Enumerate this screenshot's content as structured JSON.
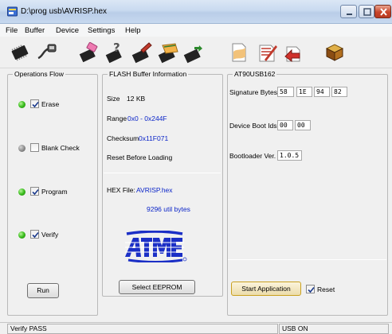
{
  "window": {
    "title": "D:\\prog usb\\AVRISP.hex"
  },
  "menu": [
    "File",
    "Buffer",
    "Device",
    "Settings",
    "Help"
  ],
  "toolbar": {
    "icons": [
      "chip-select-icon",
      "usb-connect-icon",
      "erase-chip-icon",
      "blank-check-icon",
      "program-chip-icon",
      "verify-chip-icon",
      "read-chip-icon",
      "load-hex-icon",
      "edit-buffer-icon",
      "save-buffer-icon",
      "help-book-icon"
    ]
  },
  "operations": {
    "title": "Operations Flow",
    "items": [
      {
        "label": "Erase",
        "checked": true,
        "led": "on"
      },
      {
        "label": "Blank Check",
        "checked": false,
        "led": "off"
      },
      {
        "label": "Program",
        "checked": true,
        "led": "on"
      },
      {
        "label": "Verify",
        "checked": true,
        "led": "on"
      }
    ],
    "run_label": "Run"
  },
  "flash": {
    "title": "FLASH Buffer Information",
    "size_label": "Size",
    "size_value": "12 KB",
    "range_label": "Range",
    "range_value": "0x0 - 0x244F",
    "checksum_label": "Checksum",
    "checksum_value": "0x11F071",
    "reset_text": "Reset Before Loading",
    "hex_label": "HEX File:",
    "hex_file": "AVRISP.hex",
    "util_bytes": "9296 util bytes",
    "logo_text": "AtMEL",
    "select_eeprom_label": "Select EEPROM"
  },
  "device": {
    "title": "AT90USB162",
    "signature_label": "Signature Bytes",
    "signature_bytes": [
      "58",
      "1E",
      "94",
      "82"
    ],
    "boot_ids_label": "Device Boot Ids",
    "boot_ids": [
      "00",
      "00"
    ],
    "bootloader_label": "Bootloader Ver.",
    "bootloader_version": "1.0.5",
    "start_app_label": "Start Application",
    "reset_label": "Reset",
    "reset_checked": true
  },
  "status": {
    "left": "Verify PASS",
    "right": "USB ON"
  },
  "colors": {
    "accent_blue": "#0a24c8",
    "led_on": "#3bbd1e",
    "led_off": "#8c8c8c",
    "atmel_blue": "#1b2fc6"
  }
}
